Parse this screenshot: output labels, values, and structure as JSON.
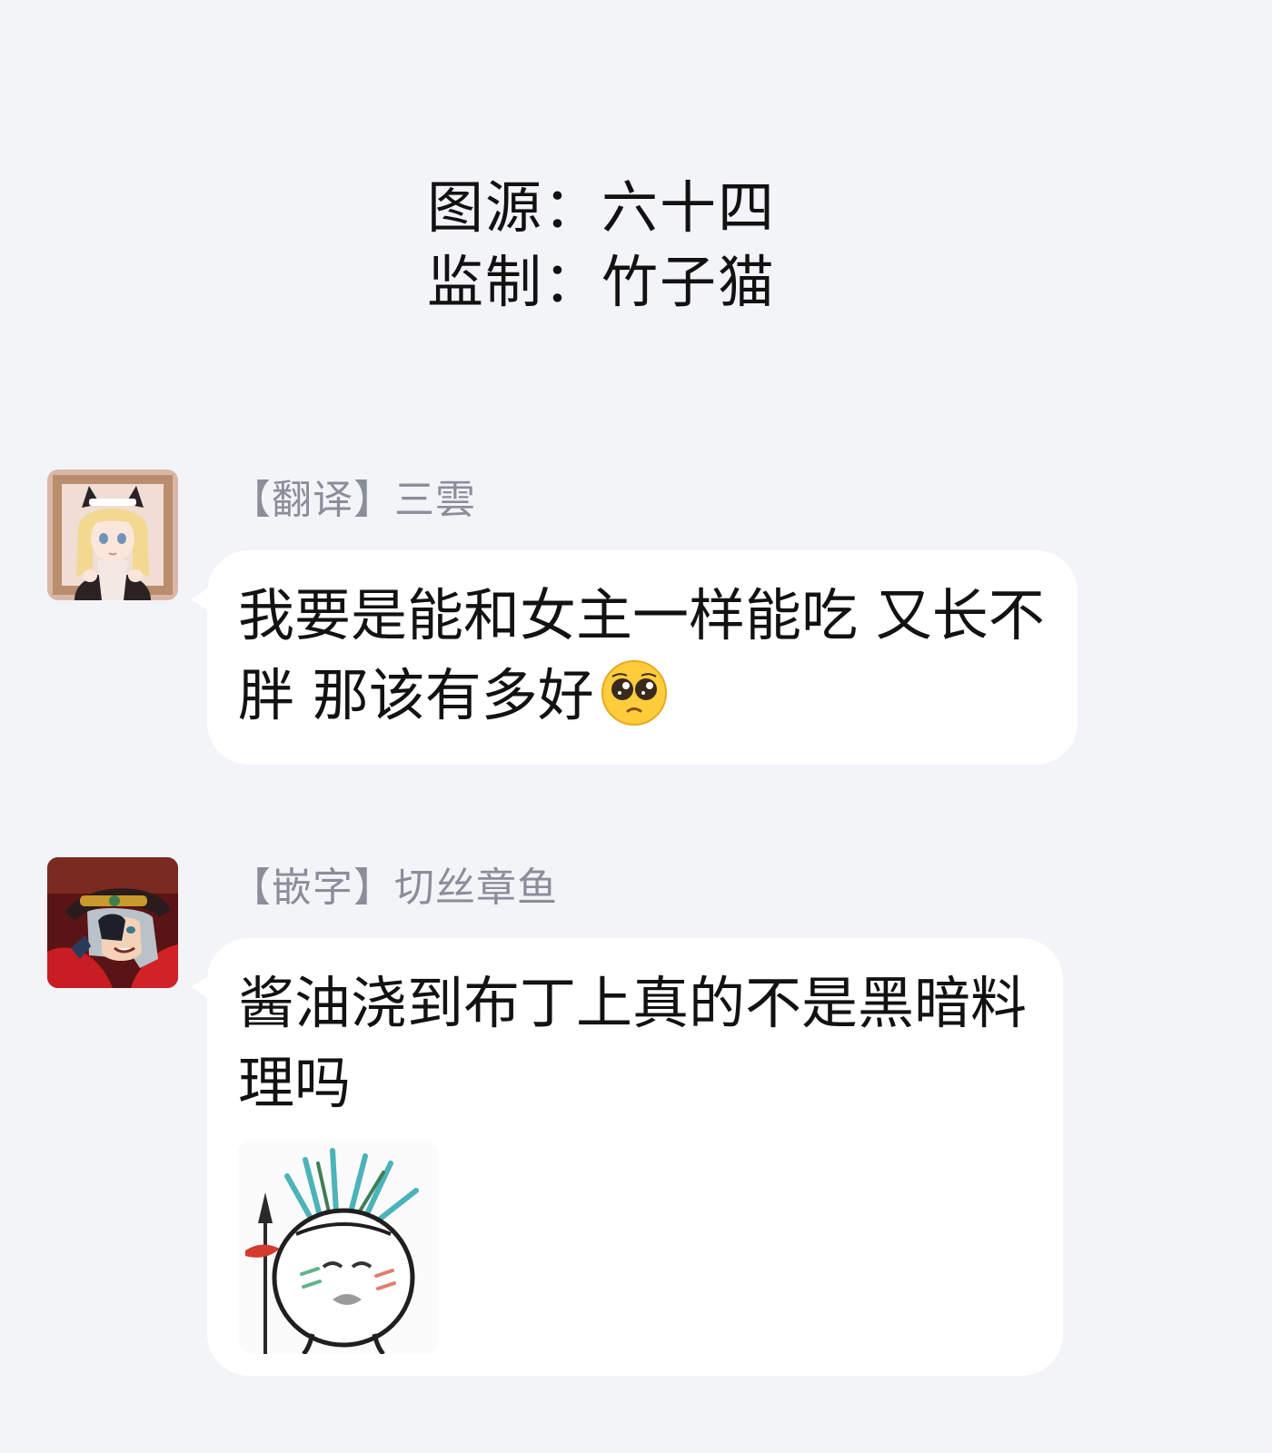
{
  "credits": {
    "line1": "图源：六十四",
    "line2": "监制：竹子猫"
  },
  "messages": [
    {
      "sender": "【翻译】三雲",
      "avatar_icon": "cat-maid-avatar",
      "text": "我要是能和女主一样能吃 又长不胖 那该有多好",
      "emoji": "pleading-face-emoji"
    },
    {
      "sender": "【嵌字】切丝章鱼",
      "avatar_icon": "pirate-hat-avatar",
      "text": "酱油浇到布丁上真的不是黑暗料理吗",
      "sticker": "onion-head-spear-sticker"
    }
  ],
  "colors": {
    "background": "#f3f4f8",
    "bubble": "#ffffff",
    "sender_name": "#8a8e99",
    "text": "#121212"
  }
}
